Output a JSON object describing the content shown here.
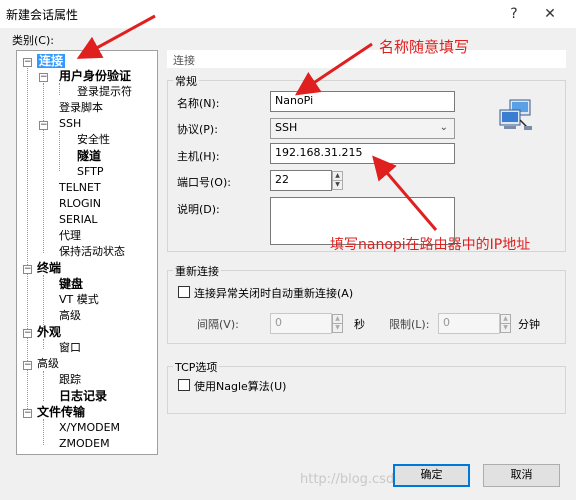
{
  "window": {
    "title": "新建会话属性",
    "help": "?",
    "close": "✕"
  },
  "tree": {
    "label": "类别(C):",
    "nodes": [
      {
        "label": "连接",
        "bold": true,
        "selected": true
      },
      {
        "label": "用户身份验证",
        "bold": true
      },
      {
        "label": "登录提示符"
      },
      {
        "label": "登录脚本"
      },
      {
        "label": "SSH"
      },
      {
        "label": "安全性"
      },
      {
        "label": "隧道",
        "bold": true
      },
      {
        "label": "SFTP"
      },
      {
        "label": "TELNET"
      },
      {
        "label": "RLOGIN"
      },
      {
        "label": "SERIAL"
      },
      {
        "label": "代理"
      },
      {
        "label": "保持活动状态"
      },
      {
        "label": "终端",
        "bold": true
      },
      {
        "label": "键盘",
        "bold": true
      },
      {
        "label": "VT 模式"
      },
      {
        "label": "高级"
      },
      {
        "label": "外观",
        "bold": true
      },
      {
        "label": "窗口"
      },
      {
        "label": "高级"
      },
      {
        "label": "跟踪"
      },
      {
        "label": "日志记录",
        "bold": true
      },
      {
        "label": "文件传输",
        "bold": true
      },
      {
        "label": "X/YMODEM"
      },
      {
        "label": "ZMODEM"
      }
    ]
  },
  "panel": {
    "header": "连接",
    "general": {
      "title": "常规",
      "name_label": "名称(N):",
      "name_value": "NanoPi",
      "protocol_label": "协议(P):",
      "protocol_value": "SSH",
      "host_label": "主机(H):",
      "host_value": "192.168.31.215",
      "port_label": "端口号(O):",
      "port_value": "22",
      "desc_label": "说明(D):",
      "desc_value": ""
    },
    "reconnect": {
      "title": "重新连接",
      "checkbox_label": "连接异常关闭时自动重新连接(A)",
      "interval_label": "间隔(V):",
      "interval_value": "0",
      "interval_unit": "秒",
      "limit_label": "限制(L):",
      "limit_value": "0",
      "limit_unit": "分钟"
    },
    "tcp": {
      "title": "TCP选项",
      "nagle_label": "使用Nagle算法(U)"
    }
  },
  "buttons": {
    "ok": "确定",
    "cancel": "取消"
  },
  "annotations": {
    "name_hint": "名称随意填写",
    "ip_hint": "填写nanopi在路由器中的IP地址",
    "color": "#e01f1f"
  },
  "watermark": "http://blog.csdn.net/..."
}
